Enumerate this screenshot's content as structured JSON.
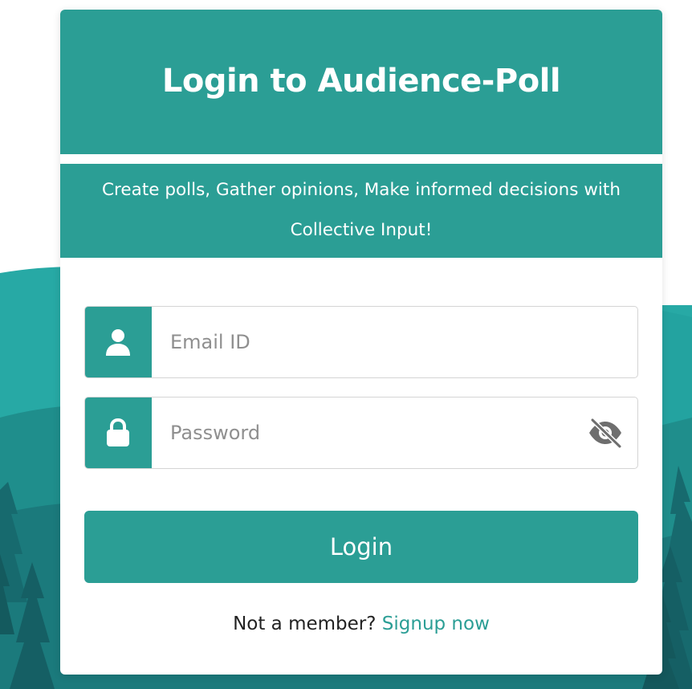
{
  "page": {
    "title": "Login to Audience-Poll",
    "tagline_line1": "Create polls, Gather opinions, Make informed decisions with",
    "tagline_line2": "Collective Input!"
  },
  "form": {
    "email": {
      "placeholder": "Email ID",
      "value": "",
      "icon": "user-icon"
    },
    "password": {
      "placeholder": "Password",
      "value": "",
      "icon": "lock-icon",
      "toggle_icon": "eye-slash-icon"
    },
    "login_label": "Login"
  },
  "signup": {
    "prompt": "Not a member?",
    "link_label": "Signup now"
  },
  "colors": {
    "accent": "#2b9e95",
    "background_hills_light": "#2aaea9",
    "background_hills_dark": "#1a6f73",
    "text_dark": "#222222",
    "placeholder": "#8f8f8f"
  }
}
